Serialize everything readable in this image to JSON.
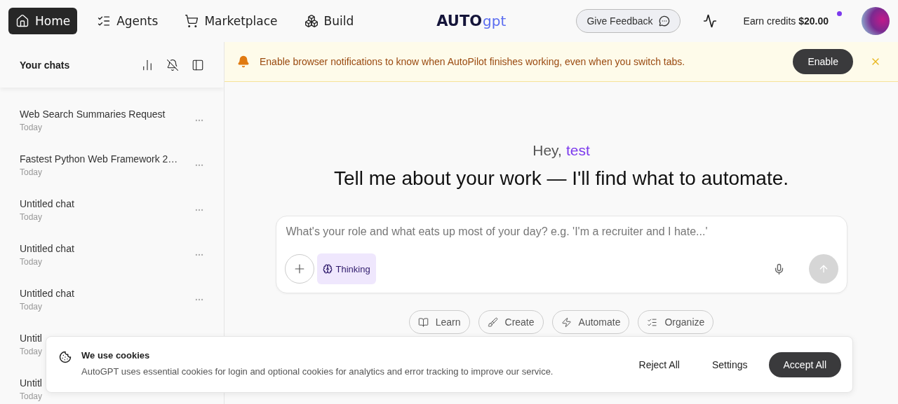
{
  "nav": {
    "items": [
      {
        "label": "Home",
        "selected": true
      },
      {
        "label": "Agents",
        "selected": false
      },
      {
        "label": "Marketplace",
        "selected": false
      },
      {
        "label": "Build",
        "selected": false
      }
    ],
    "logo": {
      "text": "AUTO",
      "accent": "gpt"
    },
    "feedback": "Give Feedback",
    "credits": "Earn credits **$20.00**"
  },
  "sidebar": {
    "title": "Your chats",
    "chats": [
      {
        "title": "Web Search Summaries Request",
        "date": "Today"
      },
      {
        "title": "Fastest Python Web Framework 2…",
        "date": "Today"
      },
      {
        "title": "Untitled chat",
        "date": "Today"
      },
      {
        "title": "Untitled chat",
        "date": "Today"
      },
      {
        "title": "Untitled chat",
        "date": "Today"
      },
      {
        "title": "Untitl",
        "date": "Today"
      },
      {
        "title": "Untitl",
        "date": "Today"
      }
    ]
  },
  "notice": {
    "text": "Enable browser notifications to know when AutoPilot finishes working, even when you switch tabs.",
    "button": "Enable"
  },
  "greeting": {
    "hello": "Hey,",
    "name": "test",
    "headline": "Tell me about your work — I'll find what to automate."
  },
  "composer": {
    "placeholder": "What's your role and what eats up most of your day? e.g. 'I'm a recruiter and I hate...'",
    "thinking": "Thinking"
  },
  "suggestions": [
    {
      "label": "Learn"
    },
    {
      "label": "Create"
    },
    {
      "label": "Automate"
    },
    {
      "label": "Organize"
    }
  ],
  "cookies": {
    "title": "We use cookies",
    "text": "AutoGPT uses essential cookies for login and optional cookies for analytics and error tracking to improve our service.",
    "buttons": [
      {
        "label": "Reject All",
        "kind": "plain"
      },
      {
        "label": "Settings",
        "kind": "plain"
      },
      {
        "label": "Accept All",
        "kind": "primary"
      }
    ]
  }
}
